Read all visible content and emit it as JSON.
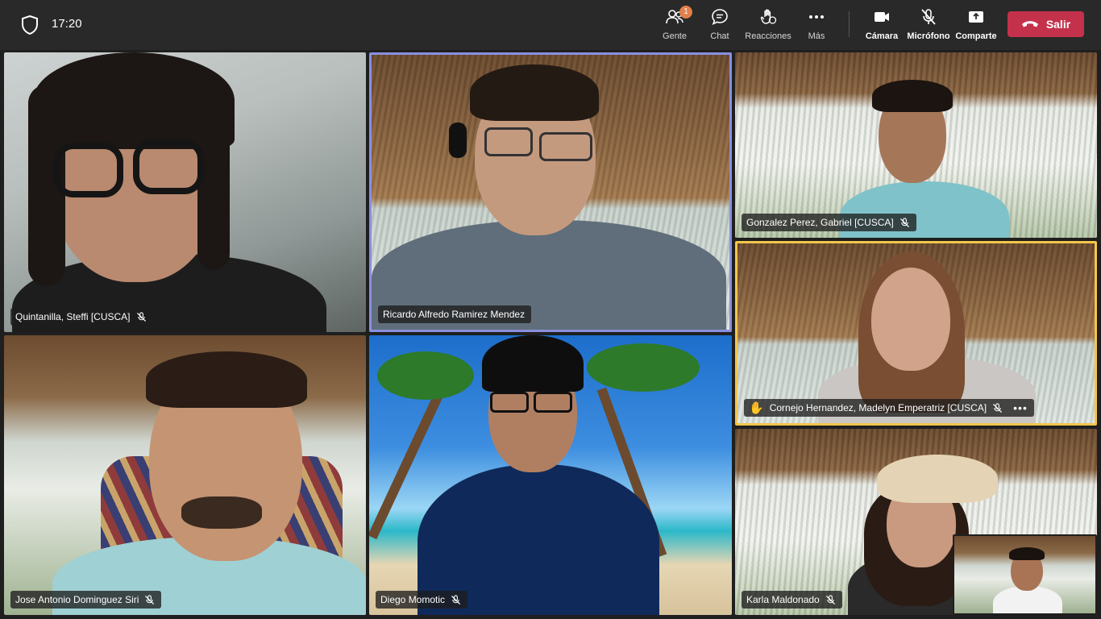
{
  "status": {
    "time": "17:20"
  },
  "controls": {
    "people": {
      "label": "Gente",
      "badge": "1"
    },
    "chat": {
      "label": "Chat"
    },
    "reactions": {
      "label": "Reacciones"
    },
    "more": {
      "label": "Más"
    },
    "camera": {
      "label": "Cámara"
    },
    "mic": {
      "label": "Micrófono"
    },
    "share": {
      "label": "Comparte"
    },
    "leave": {
      "label": "Salir"
    }
  },
  "colors": {
    "leave_button": "#c4314b",
    "active_speaker_border": "#8a8fe0",
    "raised_hand_border": "#f4c54a",
    "badge": "#e0804a"
  },
  "participants": [
    {
      "name": "Quintanilla, Steffi [CUSCA]",
      "muted": true
    },
    {
      "name": "Ricardo Alfredo Ramirez Mendez",
      "muted": false,
      "active_speaker": true
    },
    {
      "name": "Gonzalez Perez, Gabriel [CUSCA]",
      "muted": true
    },
    {
      "name": "Cornejo Hernandez, Madelyn Emperatriz [CUSCA]",
      "muted": true,
      "hand_raised": true
    },
    {
      "name": "Jose Antonio Dominguez Siri",
      "muted": true
    },
    {
      "name": "Diego Momotic",
      "muted": true
    },
    {
      "name": "Karla Maldonado",
      "muted": true
    }
  ],
  "icons": {
    "security": "shield-icon",
    "people": "people-icon",
    "chat": "chat-icon",
    "reactions": "hand-icon",
    "more": "more-dots-icon",
    "camera": "camera-icon",
    "mic": "mic-off-icon",
    "share": "share-icon",
    "leave": "phone-hangup-icon",
    "raise_hand": "raised-hand-icon"
  }
}
